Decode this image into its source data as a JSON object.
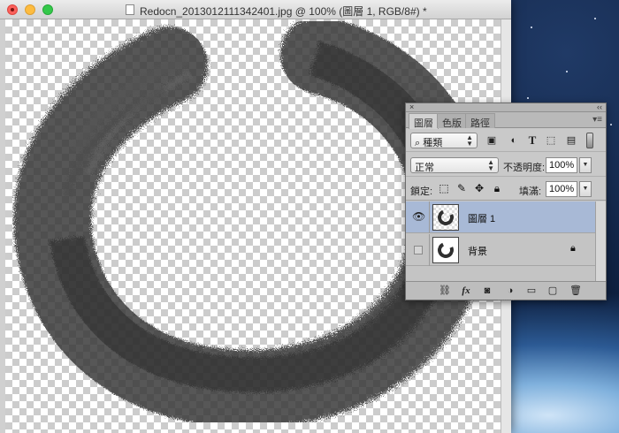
{
  "window": {
    "title": "Redocn_2013012111342401.jpg @ 100% (圖層 1, RGB/8#) *"
  },
  "layers_panel": {
    "close_glyph": "×",
    "collapse_glyph": "‹‹",
    "tabs": [
      {
        "label": "圖層",
        "active": true
      },
      {
        "label": "色版",
        "active": false
      },
      {
        "label": "路徑",
        "active": false
      }
    ],
    "menu_glyph": "▾≡",
    "filter": {
      "label": "種類",
      "icons": [
        "image-filter-icon",
        "adjustment-filter-icon",
        "type-filter-icon",
        "shape-filter-icon",
        "smart-object-filter-icon"
      ]
    },
    "blend_mode": "正常",
    "opacity_label": "不透明度:",
    "opacity_value": "100%",
    "lock_label": "鎖定:",
    "fill_label": "填滿:",
    "fill_value": "100%",
    "layers": [
      {
        "name": "圖層 1",
        "visible": true,
        "selected": true,
        "locked": false
      },
      {
        "name": "背景",
        "visible": false,
        "selected": false,
        "locked": true
      }
    ],
    "footer_icons": [
      "link-icon",
      "fx-icon",
      "mask-icon",
      "adjustment-icon",
      "folder-icon",
      "new-layer-icon",
      "trash-icon"
    ]
  },
  "colors": {
    "selected_layer": "#a8b9d6",
    "brush_stroke": "#3a3a3a"
  }
}
